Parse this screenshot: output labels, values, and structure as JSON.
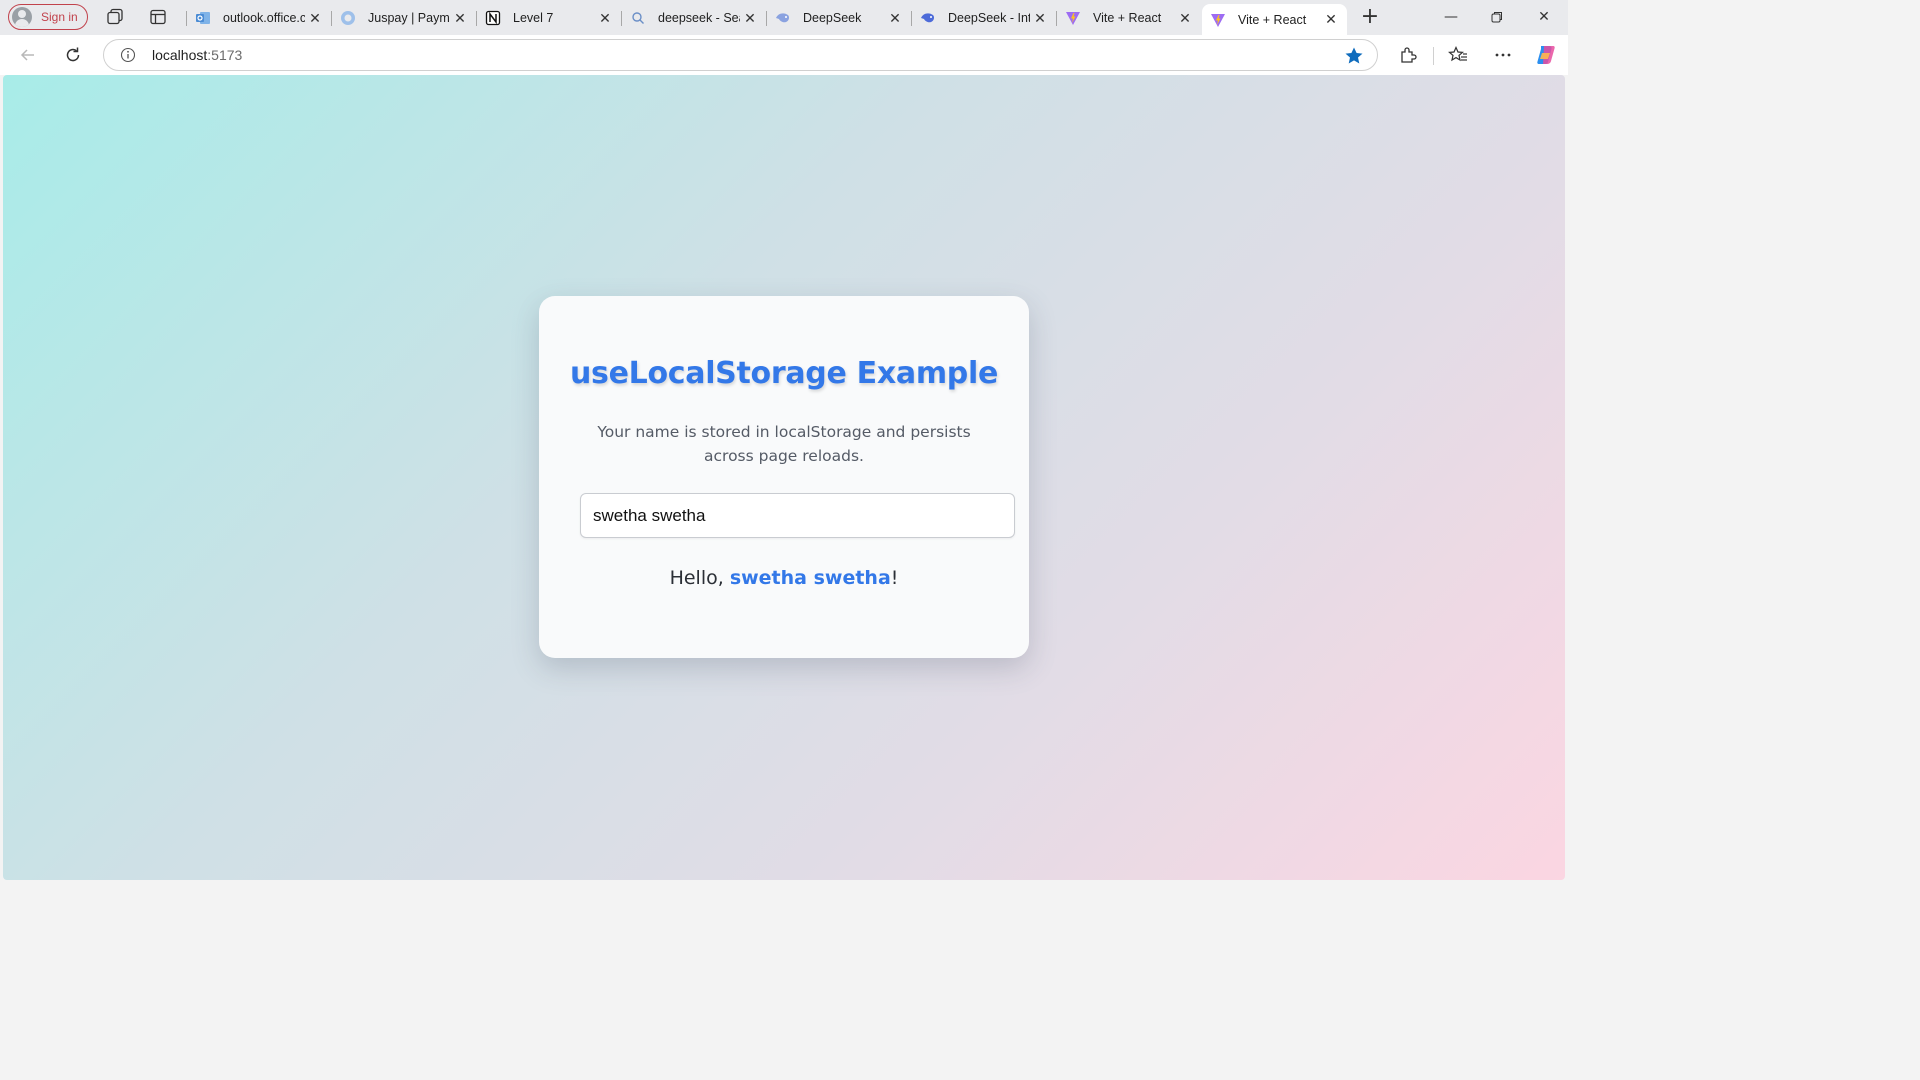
{
  "browser": {
    "signin_label": "Sign in",
    "tabs": [
      {
        "title": "outlook.office.com",
        "icon": "outlook-icon"
      },
      {
        "title": "Juspay | Payments",
        "icon": "juspay-icon"
      },
      {
        "title": "Level 7",
        "icon": "notion-icon"
      },
      {
        "title": "deepseek - Search",
        "icon": "search-icon"
      },
      {
        "title": "DeepSeek",
        "icon": "deepseek-icon"
      },
      {
        "title": "DeepSeek - Into the Unknown",
        "icon": "deepseek-icon"
      },
      {
        "title": "Vite + React",
        "icon": "vite-icon"
      },
      {
        "title": "Vite + React",
        "icon": "vite-icon",
        "active": true
      }
    ],
    "address": {
      "host": "localhost",
      "port": ":5173"
    },
    "accent_color": "#0f6cbd"
  },
  "app": {
    "title": "useLocalStorage Example",
    "description": "Your name is stored in localStorage and persists across page reloads.",
    "name_input_value": "swetha swetha",
    "greeting_prefix": "Hello, ",
    "greeting_name": "swetha swetha",
    "greeting_suffix": "!",
    "accent_color": "#3378e8"
  }
}
